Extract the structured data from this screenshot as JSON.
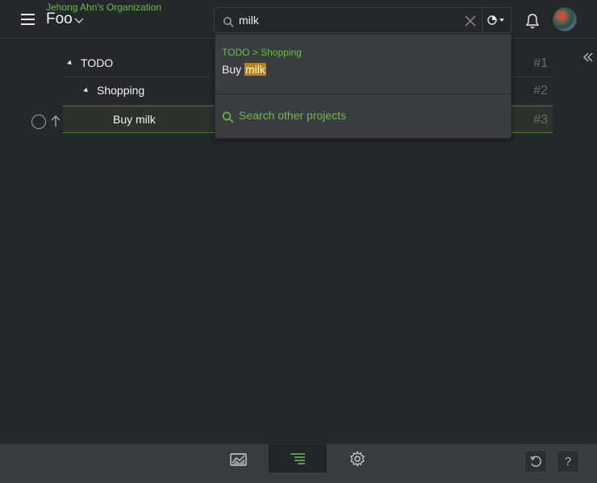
{
  "header": {
    "organization": "Jehong Ahn's Organization",
    "project": "Foo"
  },
  "search": {
    "value": "milk",
    "placeholder": ""
  },
  "tree": {
    "rows": [
      {
        "label": "TODO",
        "number": "#1"
      },
      {
        "label": "Shopping",
        "number": "#2"
      },
      {
        "label": "Buy milk",
        "number": "#3"
      }
    ]
  },
  "dropdown": {
    "breadcrumb": "TODO > Shopping",
    "result_prefix": "Buy ",
    "result_match": "milk",
    "other_projects": "Search other projects"
  },
  "footer": {
    "help": "?"
  },
  "colors": {
    "accent": "#6abd45",
    "highlight": "#b4841f",
    "background": "#25282b"
  },
  "icons": [
    "menu-icon",
    "chevron-down-icon",
    "search-icon",
    "close-icon",
    "pie-filter-icon",
    "bell-icon",
    "double-chevron-left-icon",
    "circle-icon",
    "arrow-up-icon",
    "chart-icon",
    "outline-icon",
    "gear-icon",
    "undo-icon",
    "help-icon"
  ]
}
